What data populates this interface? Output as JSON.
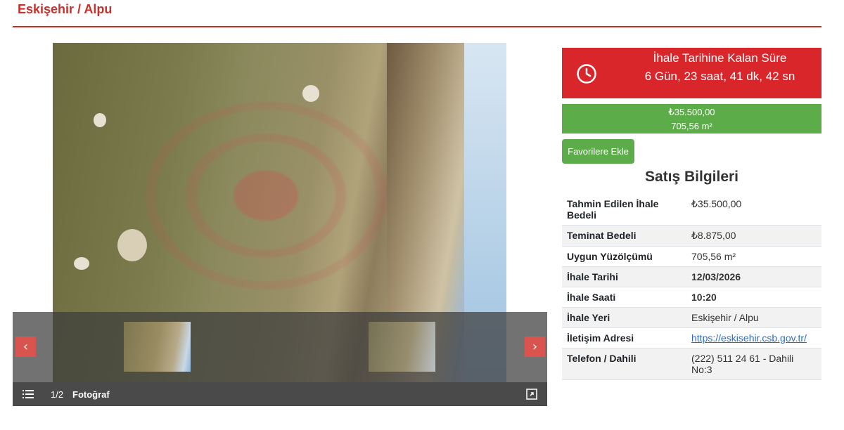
{
  "page": {
    "title": "Eskişehir / Alpu"
  },
  "gallery": {
    "counter": "1/2",
    "type_label": "Fotoğraf",
    "prev_label": "‹",
    "next_label": "›",
    "icons": {
      "list": "list-icon",
      "expand": "expand-icon",
      "prev": "chevron-left-icon",
      "next": "chevron-right-icon"
    }
  },
  "countdown": {
    "title": "İhale Tarihine Kalan Süre",
    "time": "6 Gün, 23 saat, 41 dk, 42 sn",
    "icon": "clock-icon",
    "color": "#d9262a"
  },
  "price": {
    "amount": "₺35.500,00",
    "area": "705,56 m²",
    "color": "#5cad4a"
  },
  "favorite_button": "Favorilere Ekle",
  "section_title": "Satış Bilgileri",
  "info": [
    {
      "key": "Tahmin Edilen İhale Bedeli",
      "value": "₺35.500,00"
    },
    {
      "key": "Teminat Bedeli",
      "value": "₺8.875,00"
    },
    {
      "key": "Uygun Yüzölçümü",
      "value": "705,56 m²"
    },
    {
      "key": "İhale Tarihi",
      "value": "12/03/2026"
    },
    {
      "key": "İhale Saati",
      "value": "10:20"
    },
    {
      "key": "İhale Yeri",
      "value": "Eskişehir / Alpu"
    },
    {
      "key": "İletişim Adresi",
      "value": "https://eskisehir.csb.gov.tr/"
    },
    {
      "key": "Telefon / Dahili",
      "value": "(222) 511 24 61 - Dahili No:3"
    }
  ]
}
